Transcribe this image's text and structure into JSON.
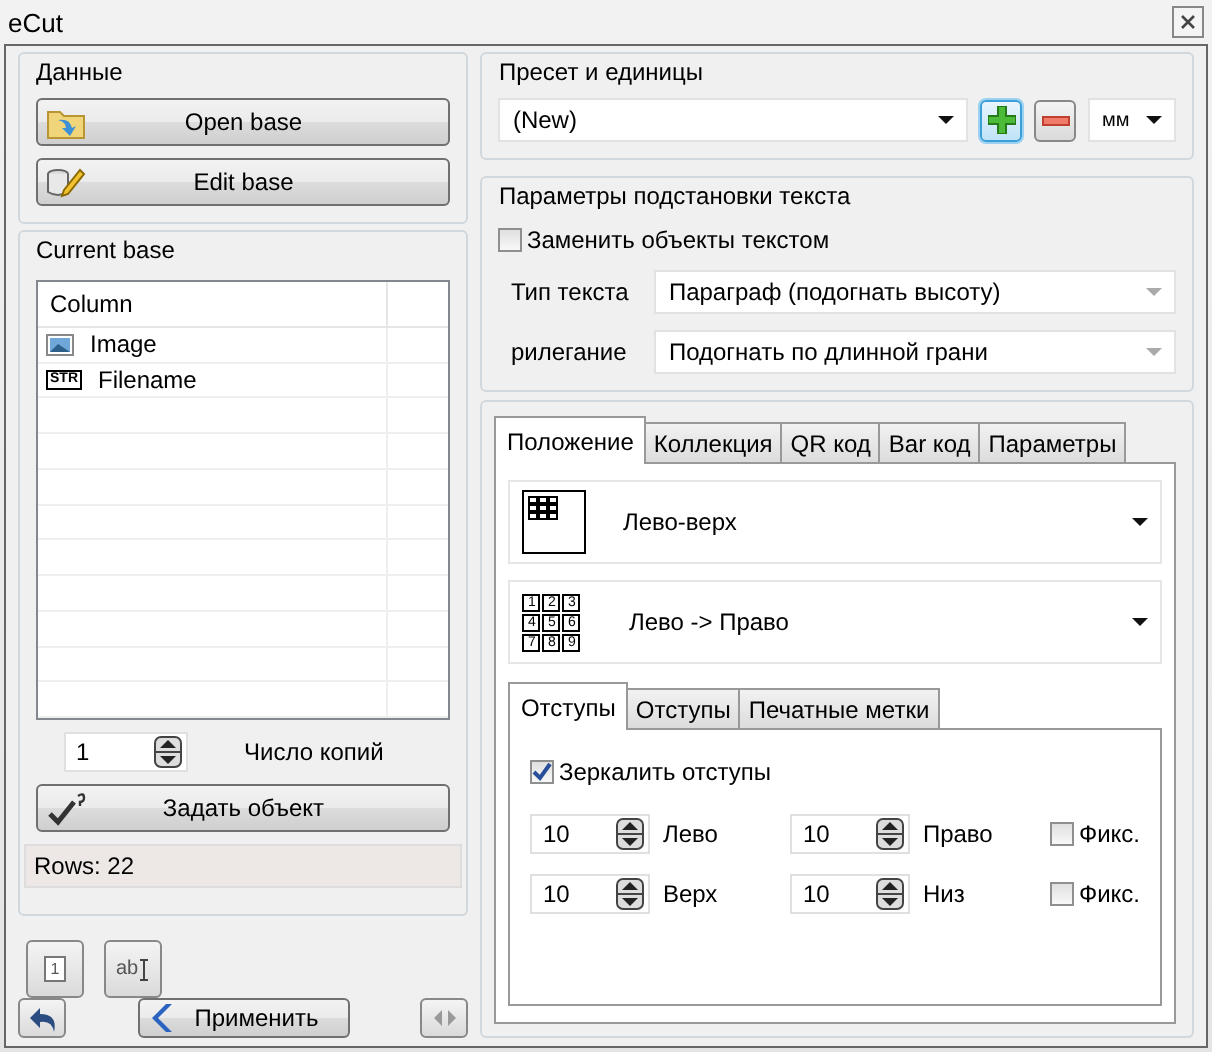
{
  "window": {
    "title": "eCut"
  },
  "data_group": {
    "title": "Данные",
    "buttons": [
      {
        "kind": "folder",
        "label": "Open base"
      },
      {
        "kind": "edit",
        "label": "Edit base"
      }
    ]
  },
  "current_base": {
    "title": "Current base",
    "table": {
      "columns": [
        "Column"
      ],
      "rows": [
        {
          "kind": "image",
          "name": "Image"
        },
        {
          "kind": "string",
          "badge": "STR",
          "name": "Filename"
        }
      ]
    },
    "copies": {
      "value": "1",
      "label": "Число копий"
    },
    "set_object_button": "Задать объект",
    "status": "Rows: 22"
  },
  "tools": [
    {
      "kind": "page",
      "text": "1"
    },
    {
      "kind": "text",
      "text": "ab"
    }
  ],
  "apply_button": "Применить",
  "preset": {
    "title": "Пресет и единицы",
    "value": "(New)",
    "add_focused": true,
    "units": "мм"
  },
  "text_substitution": {
    "title": "Параметры подстановки текста",
    "replace": {
      "label": "Заменить объекты текстом",
      "checked": false
    },
    "fields": [
      {
        "label": "Тип текста",
        "value": "Параграф (подогнать высоту)"
      },
      {
        "label": "рилегание",
        "value": "Подогнать по длинной грани"
      }
    ]
  },
  "tabs": [
    {
      "label": "Положение",
      "selected": true
    },
    {
      "label": "Коллекция",
      "selected": false
    },
    {
      "label": "QR код",
      "selected": false
    },
    {
      "label": "Bar код",
      "selected": false
    },
    {
      "label": "Параметры",
      "selected": false
    }
  ],
  "position": {
    "anchor": "Лево-верх",
    "order": "Лево -> Право",
    "order_digits": [
      "1",
      "2",
      "3",
      "4",
      "5",
      "6",
      "7",
      "8",
      "9"
    ]
  },
  "sub_tabs": [
    {
      "label": "Отступы",
      "selected": true
    },
    {
      "label": "Отступы",
      "selected": false
    },
    {
      "label": "Печатные метки",
      "selected": false
    }
  ],
  "margins": {
    "mirror": {
      "label": "Зеркалить отступы",
      "checked": true
    },
    "rows": [
      {
        "first_value": "10",
        "first_label": "Лево",
        "second_value": "10",
        "second_label": "Право",
        "fix": {
          "label": "Фикс.",
          "checked": false
        }
      },
      {
        "first_value": "10",
        "first_label": "Верх",
        "second_value": "10",
        "second_label": "Низ",
        "fix": {
          "label": "Фикс.",
          "checked": false
        }
      }
    ]
  }
}
